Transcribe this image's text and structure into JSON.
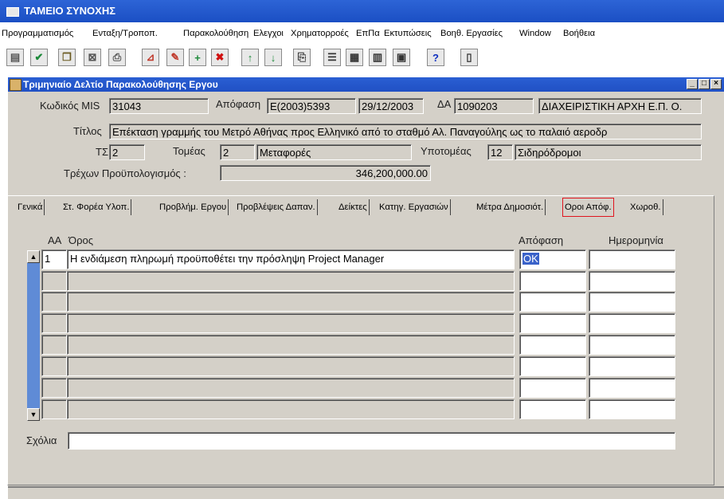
{
  "app": {
    "title": "ΤΑΜΕΙΟ ΣΥΝΟΧΗΣ"
  },
  "menu": [
    "Προγραμματισμός",
    "Ενταξη/Τροποπ.",
    "Παρακολούθηση",
    "Ελεγχοι",
    "Χρηματορροές",
    "ΕπΠα",
    "Εκτυπώσεις",
    "Βοηθ. Εργασίες",
    "Window",
    "Βοήθεια"
  ],
  "window": {
    "title": "Τριμηνιαίο Δελτίο Παρακολούθησης Εργου",
    "min_glyph": "_",
    "max_glyph": "□",
    "close_glyph": "×"
  },
  "form": {
    "mis_label": "Κωδικός MIS",
    "mis_value": "31043",
    "decision_label": "Απόφαση",
    "decision_value": "E(2003)5393",
    "decision_date": "29/12/2003",
    "da_label": "ΔΑ",
    "da_value": "1090203",
    "da_name": "ΔΙΑΧΕΙΡΙΣΤΙΚΗ ΑΡΧΗ Ε.Π. Ο.",
    "title_label": "Τίτλος",
    "title_value": "Επέκταση γραμμής του Μετρό Αθήνας προς Ελληνικό από το σταθμό Αλ. Παναγούλης ως το παλαιό αεροδρ",
    "ts_label": "ΤΣ",
    "ts_value": "2",
    "sector_label": "Τομέας",
    "sector_code": "2",
    "sector_name": "Μεταφορές",
    "subsector_label": "Υποτομέας",
    "subsector_code": "12",
    "subsector_name": "Σιδηρόδρομοι",
    "budget_label": "Τρέχων Προϋπολογισμός :",
    "budget_value": "346,200,000.00"
  },
  "tabs": [
    {
      "label": "Γενικά"
    },
    {
      "label": "Στ. Φορέα Υλοπ."
    },
    {
      "label": "Προβλήμ. Εργου"
    },
    {
      "label": "Προβλέψεις Δαπαν."
    },
    {
      "label": "Δείκτες"
    },
    {
      "label": "Κατηγ. Εργασιών"
    },
    {
      "label": "Μέτρα Δημοσιότ."
    },
    {
      "label": "Οροι Απόφ.",
      "active": true
    },
    {
      "label": "Χωροθ."
    }
  ],
  "table": {
    "headers": {
      "aa": "ΑΑ",
      "term": "Όρος",
      "decision": "Απόφαση",
      "date": "Ημερομηνία"
    },
    "rows": [
      {
        "aa": "1",
        "term": "Η ενδιάμεση πληρωμή προϋποθέτει την πρόσληψη Project Manager",
        "decision": "OK",
        "date": ""
      },
      {
        "aa": "",
        "term": "",
        "decision": "",
        "date": ""
      },
      {
        "aa": "",
        "term": "",
        "decision": "",
        "date": ""
      },
      {
        "aa": "",
        "term": "",
        "decision": "",
        "date": ""
      },
      {
        "aa": "",
        "term": "",
        "decision": "",
        "date": ""
      },
      {
        "aa": "",
        "term": "",
        "decision": "",
        "date": ""
      },
      {
        "aa": "",
        "term": "",
        "decision": "",
        "date": ""
      },
      {
        "aa": "",
        "term": "",
        "decision": "",
        "date": ""
      }
    ]
  },
  "comments": {
    "label": "Σχόλια",
    "value": ""
  },
  "toolbar_icons": [
    "save-icon",
    "check-icon",
    "copy-record-icon",
    "clear-icon",
    "print-preview-icon",
    "form-icon",
    "tools-icon",
    "insert-record-icon",
    "delete-record-icon",
    "arrow-up-icon",
    "arrow-down-icon",
    "print-icon",
    "list-icon",
    "report-icon",
    "document-icon",
    "clipboard-icon",
    "help-icon",
    "exit-icon"
  ],
  "colors": {
    "title_bar": "#1b4fc4",
    "form_bg": "#d4d0c8",
    "active_tab_border": "#e0141e",
    "selection": "#3a62c9"
  }
}
